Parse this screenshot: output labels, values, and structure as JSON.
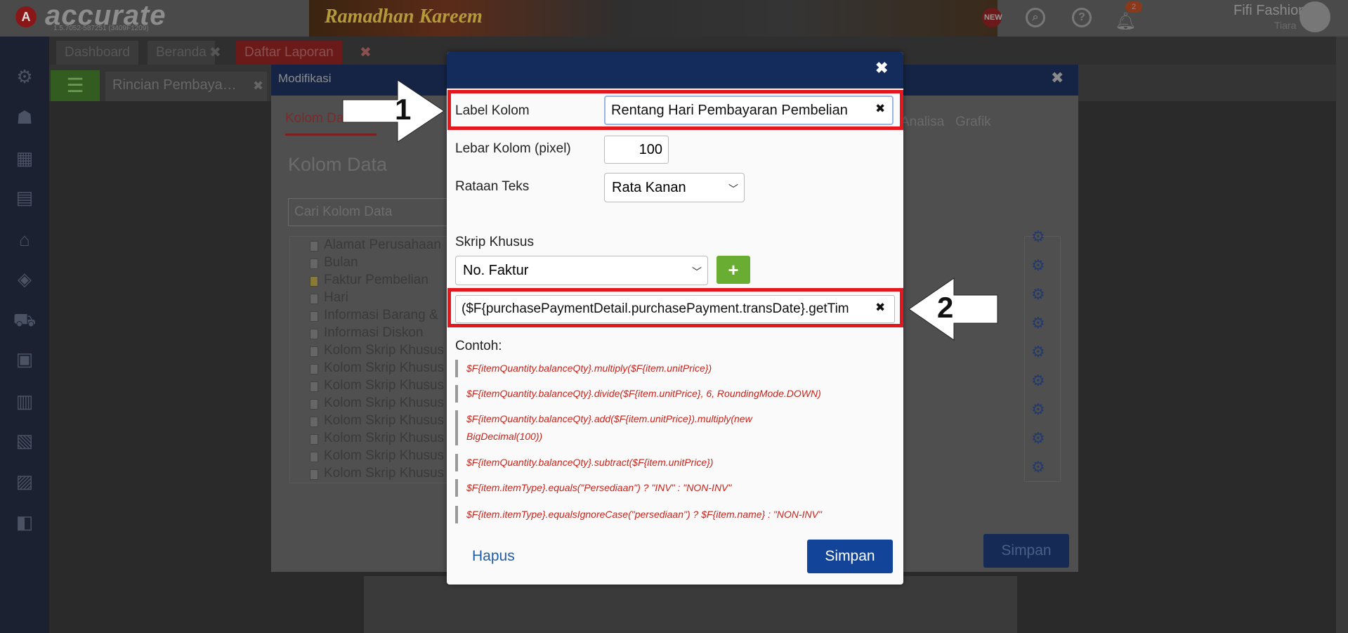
{
  "topbar": {
    "logo_text": "accurate",
    "logo_sub": "1.5.7052-587251 (3409F1209)",
    "banner_text": "Ramadhan Kareem",
    "notif_count": "2",
    "user_name": "Fifi Fashion",
    "user_sub": "Tiara"
  },
  "tabs": {
    "dashboard": "Dashboard",
    "beranda": "Beranda",
    "daftar": "Daftar Laporan",
    "rincian": "Rincian Pembaya…"
  },
  "modifikasi": {
    "title": "Modifikasi",
    "tab_active": "Kolom Data",
    "tab_analisa": "Analisa",
    "tab_grafik": "Grafik",
    "heading": "Kolom Data",
    "search_placeholder": "Cari Kolom Data",
    "tree": [
      "Alamat Perusahaan",
      "Bulan",
      "Faktur Pembelian",
      "Hari",
      "Informasi Barang &",
      "Informasi Diskon",
      "Kolom Skrip Khusus",
      "Kolom Skrip Khusus",
      "Kolom Skrip Khusus",
      "Kolom Skrip Khusus",
      "Kolom Skrip Khusus",
      "Kolom Skrip Khusus",
      "Kolom Skrip Khusus",
      "Kolom Skrip Khusus"
    ],
    "save_label": "Simpan"
  },
  "dialog": {
    "close": "✖",
    "label_kolom": "Label Kolom",
    "label_kolom_value": "Rentang Hari Pembayaran Pembelian",
    "lebar_kolom": "Lebar Kolom (pixel)",
    "lebar_value": "100",
    "rataan": "Rataan Teks",
    "rataan_value": "Rata Kanan",
    "skrip": "Skrip Khusus",
    "skrip_value": "No. Faktur",
    "add": "+",
    "script_value": "($F{purchasePaymentDetail.purchasePayment.transDate}.getTim",
    "contoh": "Contoh:",
    "examples": [
      "$F{itemQuantity.balanceQty}.multiply($F{item.unitPrice})",
      "$F{itemQuantity.balanceQty}.divide($F{item.unitPrice}, 6, RoundingMode.DOWN)",
      "$F{itemQuantity.balanceQty}.add($F{item.unitPrice}).multiply(new BigDecimal(100))",
      "$F{itemQuantity.balanceQty}.subtract($F{item.unitPrice})",
      "$F{item.itemType}.equals(\"Persediaan\") ? \"INV\" : \"NON-INV\"",
      "$F{item.itemType}.equalsIgnoreCase(\"persediaan\") ? $F{item.name} : \"NON-INV\""
    ],
    "hapus": "Hapus",
    "simpan": "Simpan"
  },
  "annotations": {
    "one": "1",
    "two": "2"
  },
  "colors": {
    "header_navy": "#142c5c",
    "save_blue": "#12449a",
    "add_green": "#6aad33",
    "example_red": "#c8231a",
    "annotation_red": "#e4171f"
  }
}
